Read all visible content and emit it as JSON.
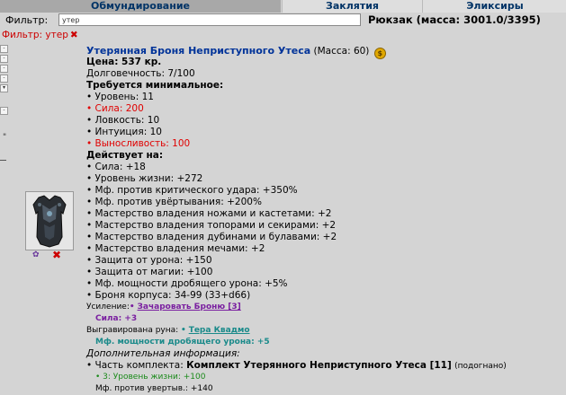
{
  "tabs": [
    {
      "label": "Обмундирование"
    },
    {
      "label": "Заклятия"
    },
    {
      "label": "Эликсиры"
    }
  ],
  "filter": {
    "label": "Фильтр:",
    "value": "утер",
    "active_label": "Фильтр: утер",
    "clear_glyph": "✖"
  },
  "backpack": {
    "text": "Рюкзак (масса: 3001.0/3395)"
  },
  "sidebar": {
    "quote": "\""
  },
  "item": {
    "name": "Утерянная Броня Неприступного Утеса",
    "mass": "(Масса: 60)",
    "price": "Цена: 537 кр.",
    "durability": "Долговечность: 7/100",
    "requires_header": "Требуется минимальное:",
    "requires": [
      {
        "text": "• Уровень: 11",
        "color": "#000000"
      },
      {
        "text": "• Сила: 200",
        "color": "#e00000"
      },
      {
        "text": "• Ловкость: 10",
        "color": "#000000"
      },
      {
        "text": "• Интуиция: 10",
        "color": "#000000"
      },
      {
        "text": "• Выносливость: 100",
        "color": "#e00000"
      }
    ],
    "effects_header": "Действует на:",
    "effects": [
      "• Сила: +18",
      "• Уровень жизни: +272",
      "• Мф. против критического удара: +350%",
      "• Мф. против увёртывания: +200%",
      "• Мастерство владения ножами и кастетами: +2",
      "• Мастерство владения топорами и секирами: +2",
      "• Мастерство владения дубинами и булавами: +2",
      "• Мастерство владения мечами: +2",
      "• Защита от урона: +150",
      "• Защита от магии: +100",
      "• Мф. мощности дробящего урона: +5%",
      "• Броня корпуса: 34-99 (33+d66)"
    ],
    "enhance": {
      "label": "Усиление:",
      "bullet": "•",
      "link": "Зачаровать Броню [3]",
      "stat": "Сила: +3"
    },
    "rune": {
      "label": "Выгравирована руна:",
      "bullet": "•",
      "link": "Тера Квадмо",
      "stat": "Мф. мощности дробящего урона: +5"
    },
    "extra_header": "Дополнительная информация:",
    "set": {
      "prefix": "• Часть комплекта:",
      "name": "Комплект Утерянного Неприступного Утеса [11]",
      "suffix": "(подогнано)"
    },
    "set_bonus_1": "• 3: Уровень жизни: +100",
    "set_bonus_2": "Мф. против увертыв.: +140"
  },
  "actions": {
    "rune_glyph": "✿",
    "delete_glyph": "✖"
  }
}
